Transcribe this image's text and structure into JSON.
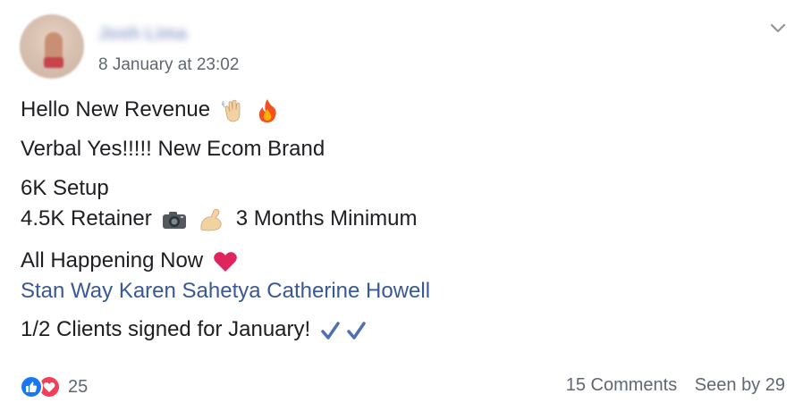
{
  "post": {
    "author": "Josh Lima",
    "timestamp": "8 January at 23:02",
    "lines": {
      "l1": "Hello New Revenue",
      "l2": "Verbal Yes!!!!! New Ecom Brand",
      "l3": "6K Setup",
      "l4a": "4.5K Retainer",
      "l4b": "3 Months Minimum",
      "l5": "All Happening Now",
      "l7": "1/2 Clients signed for January!"
    },
    "tags": [
      "Stan Way",
      "Karen Sahetya",
      "Catherine Howell"
    ],
    "icons": {
      "options": "chevron-down-icon",
      "wave": "waving-hand-icon",
      "fire": "fire-icon",
      "camera": "camera-icon",
      "muscle": "flexed-biceps-icon",
      "heart": "red-heart-icon",
      "check": "check-mark-icon",
      "like": "like-reaction-icon",
      "love": "love-reaction-icon"
    }
  },
  "footer": {
    "reaction_count": "25",
    "comments": "15 Comments",
    "seen": "Seen by 29"
  },
  "colors": {
    "link": "#385898",
    "meta": "#616770",
    "like": "#1877f2",
    "love": "#f33e58"
  }
}
